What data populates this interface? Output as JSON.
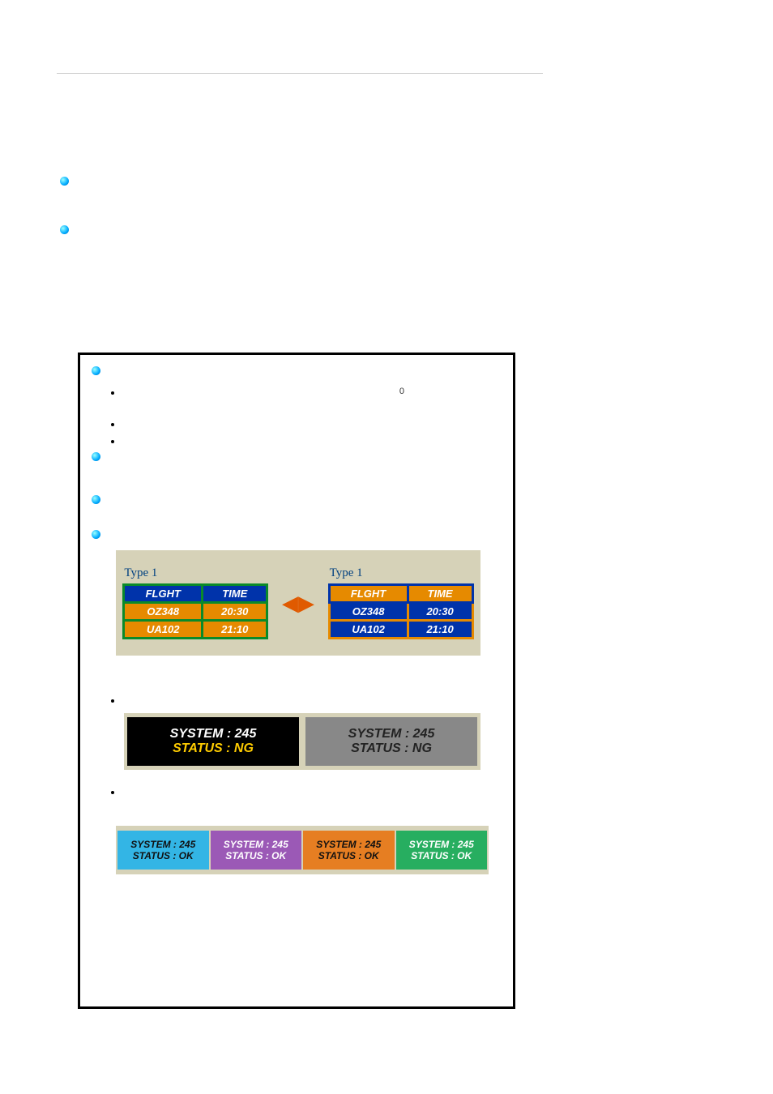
{
  "flight": {
    "title_left": "Type 1",
    "title_right": "Type 1",
    "headers": [
      "FLGHT",
      "TIME"
    ],
    "rows": [
      {
        "f": "OZ348",
        "t": "20:30"
      },
      {
        "f": "UA102",
        "t": "21:10"
      }
    ]
  },
  "status_bw": {
    "line1": "SYSTEM : 245",
    "line2": "STATUS : NG"
  },
  "status_color": {
    "line1": "SYSTEM : 245",
    "line2": "STATUS : OK"
  },
  "zero": "0"
}
